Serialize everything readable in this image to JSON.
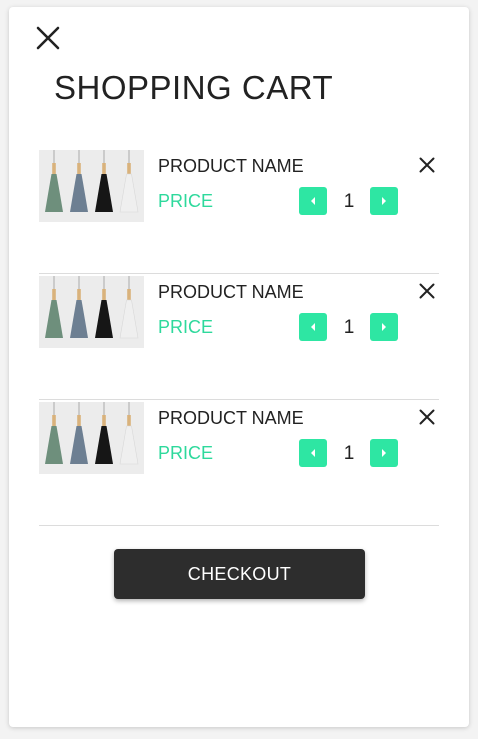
{
  "cart": {
    "title": "SHOPPING CART",
    "items": [
      {
        "name": "PRODUCT NAME",
        "price": "PRICE",
        "quantity": "1"
      },
      {
        "name": "PRODUCT NAME",
        "price": "PRICE",
        "quantity": "1"
      },
      {
        "name": "PRODUCT NAME",
        "price": "PRICE",
        "quantity": "1"
      }
    ],
    "checkout_label": "CHECKOUT"
  },
  "icons": {
    "close_panel": "close-icon",
    "remove_item": "close-icon",
    "decrement": "caret-left-icon",
    "increment": "caret-right-icon"
  },
  "colors": {
    "accent": "#2ee6a3",
    "price": "#2ed99c",
    "checkout_bg": "#2d2d2d",
    "lamps": [
      "#6e8f7c",
      "#6d7f92",
      "#161616",
      "#efefef"
    ]
  }
}
